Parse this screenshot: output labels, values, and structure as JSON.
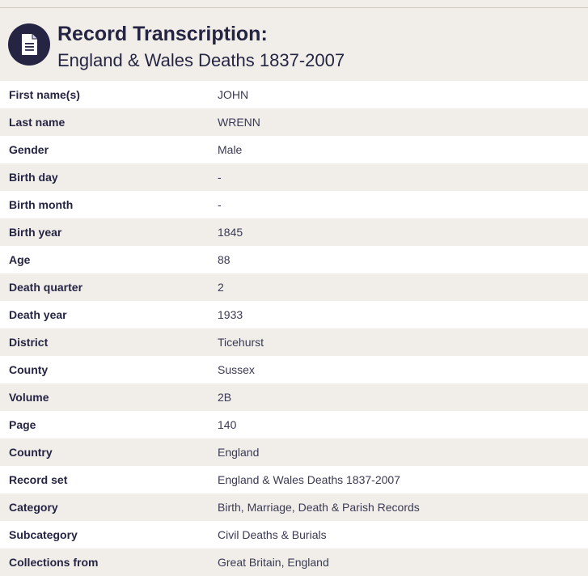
{
  "header": {
    "title": "Record Transcription:",
    "subtitle": "England & Wales Deaths 1837-2007",
    "icon": "document-icon"
  },
  "colors": {
    "brand_navy": "#252543",
    "row_alt": "#f1eeea",
    "row_white": "#ffffff"
  },
  "records": [
    {
      "label": "First name(s)",
      "value": "JOHN"
    },
    {
      "label": "Last name",
      "value": "WRENN"
    },
    {
      "label": "Gender",
      "value": "Male"
    },
    {
      "label": "Birth day",
      "value": "-"
    },
    {
      "label": "Birth month",
      "value": "-"
    },
    {
      "label": "Birth year",
      "value": "1845"
    },
    {
      "label": "Age",
      "value": "88"
    },
    {
      "label": "Death quarter",
      "value": "2"
    },
    {
      "label": "Death year",
      "value": "1933"
    },
    {
      "label": "District",
      "value": "Ticehurst"
    },
    {
      "label": "County",
      "value": "Sussex"
    },
    {
      "label": "Volume",
      "value": "2B"
    },
    {
      "label": "Page",
      "value": "140"
    },
    {
      "label": "Country",
      "value": "England"
    },
    {
      "label": "Record set",
      "value": "England & Wales Deaths 1837-2007"
    },
    {
      "label": "Category",
      "value": "Birth, Marriage, Death & Parish Records"
    },
    {
      "label": "Subcategory",
      "value": "Civil Deaths & Burials"
    },
    {
      "label": "Collections from",
      "value": "Great Britain, England"
    }
  ]
}
